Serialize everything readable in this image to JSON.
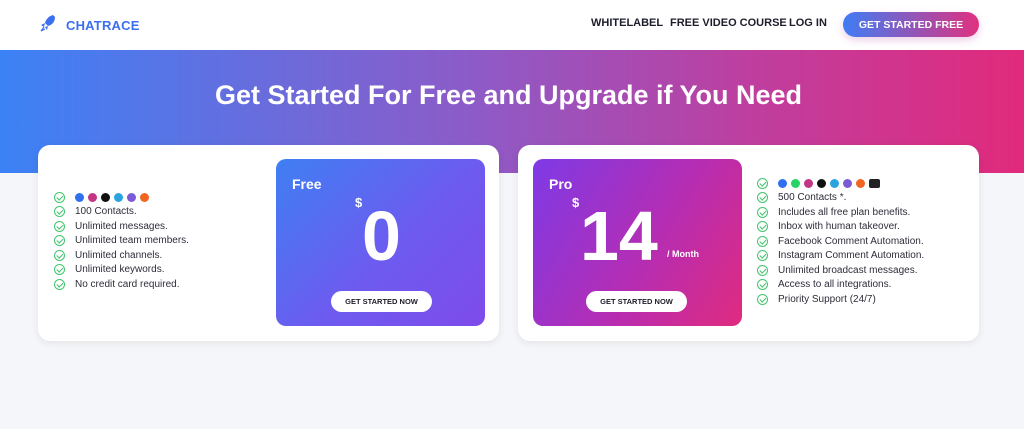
{
  "nav": {
    "brand": "CHATRACE",
    "links": [
      "WHITELABEL",
      "FREE VIDEO COURSE",
      "LOG IN"
    ],
    "cta": "GET STARTED FREE"
  },
  "hero": {
    "title": "Get Started For Free and Upgrade if You Need"
  },
  "colors": {
    "accent_blue": "#3b82f6",
    "accent_pink": "#e12a7c",
    "check_green": "#43c36e"
  },
  "free_plan": {
    "name": "Free",
    "currency": "$",
    "price": "0",
    "button": "GET STARTED NOW",
    "channel_icons": [
      "messenger-icon",
      "instagram-icon",
      "tiktok-icon",
      "telegram-icon",
      "viber-icon",
      "chat-bubble-icon"
    ],
    "features": [
      "100 Contacts.",
      "Unlimited messages.",
      "Unlimited team members.",
      "Unlimited channels.",
      "Unlimited keywords.",
      "No credit card required."
    ]
  },
  "pro_plan": {
    "name": "Pro",
    "currency": "$",
    "price": "14",
    "period": "/ Month",
    "button": "GET STARTED NOW",
    "channel_icons": [
      "messenger-icon",
      "whatsapp-icon",
      "instagram-icon",
      "tiktok-icon",
      "telegram-icon",
      "viber-icon",
      "chat-bubble-icon",
      "email-icon"
    ],
    "features": [
      "500 Contacts *.",
      "Includes all free plan benefits.",
      "Inbox with human takeover.",
      "Facebook Comment Automation.",
      "Instagram Comment Automation.",
      "Unlimited broadcast messages.",
      "Access to all integrations.",
      "Priority Support (24/7)"
    ]
  }
}
